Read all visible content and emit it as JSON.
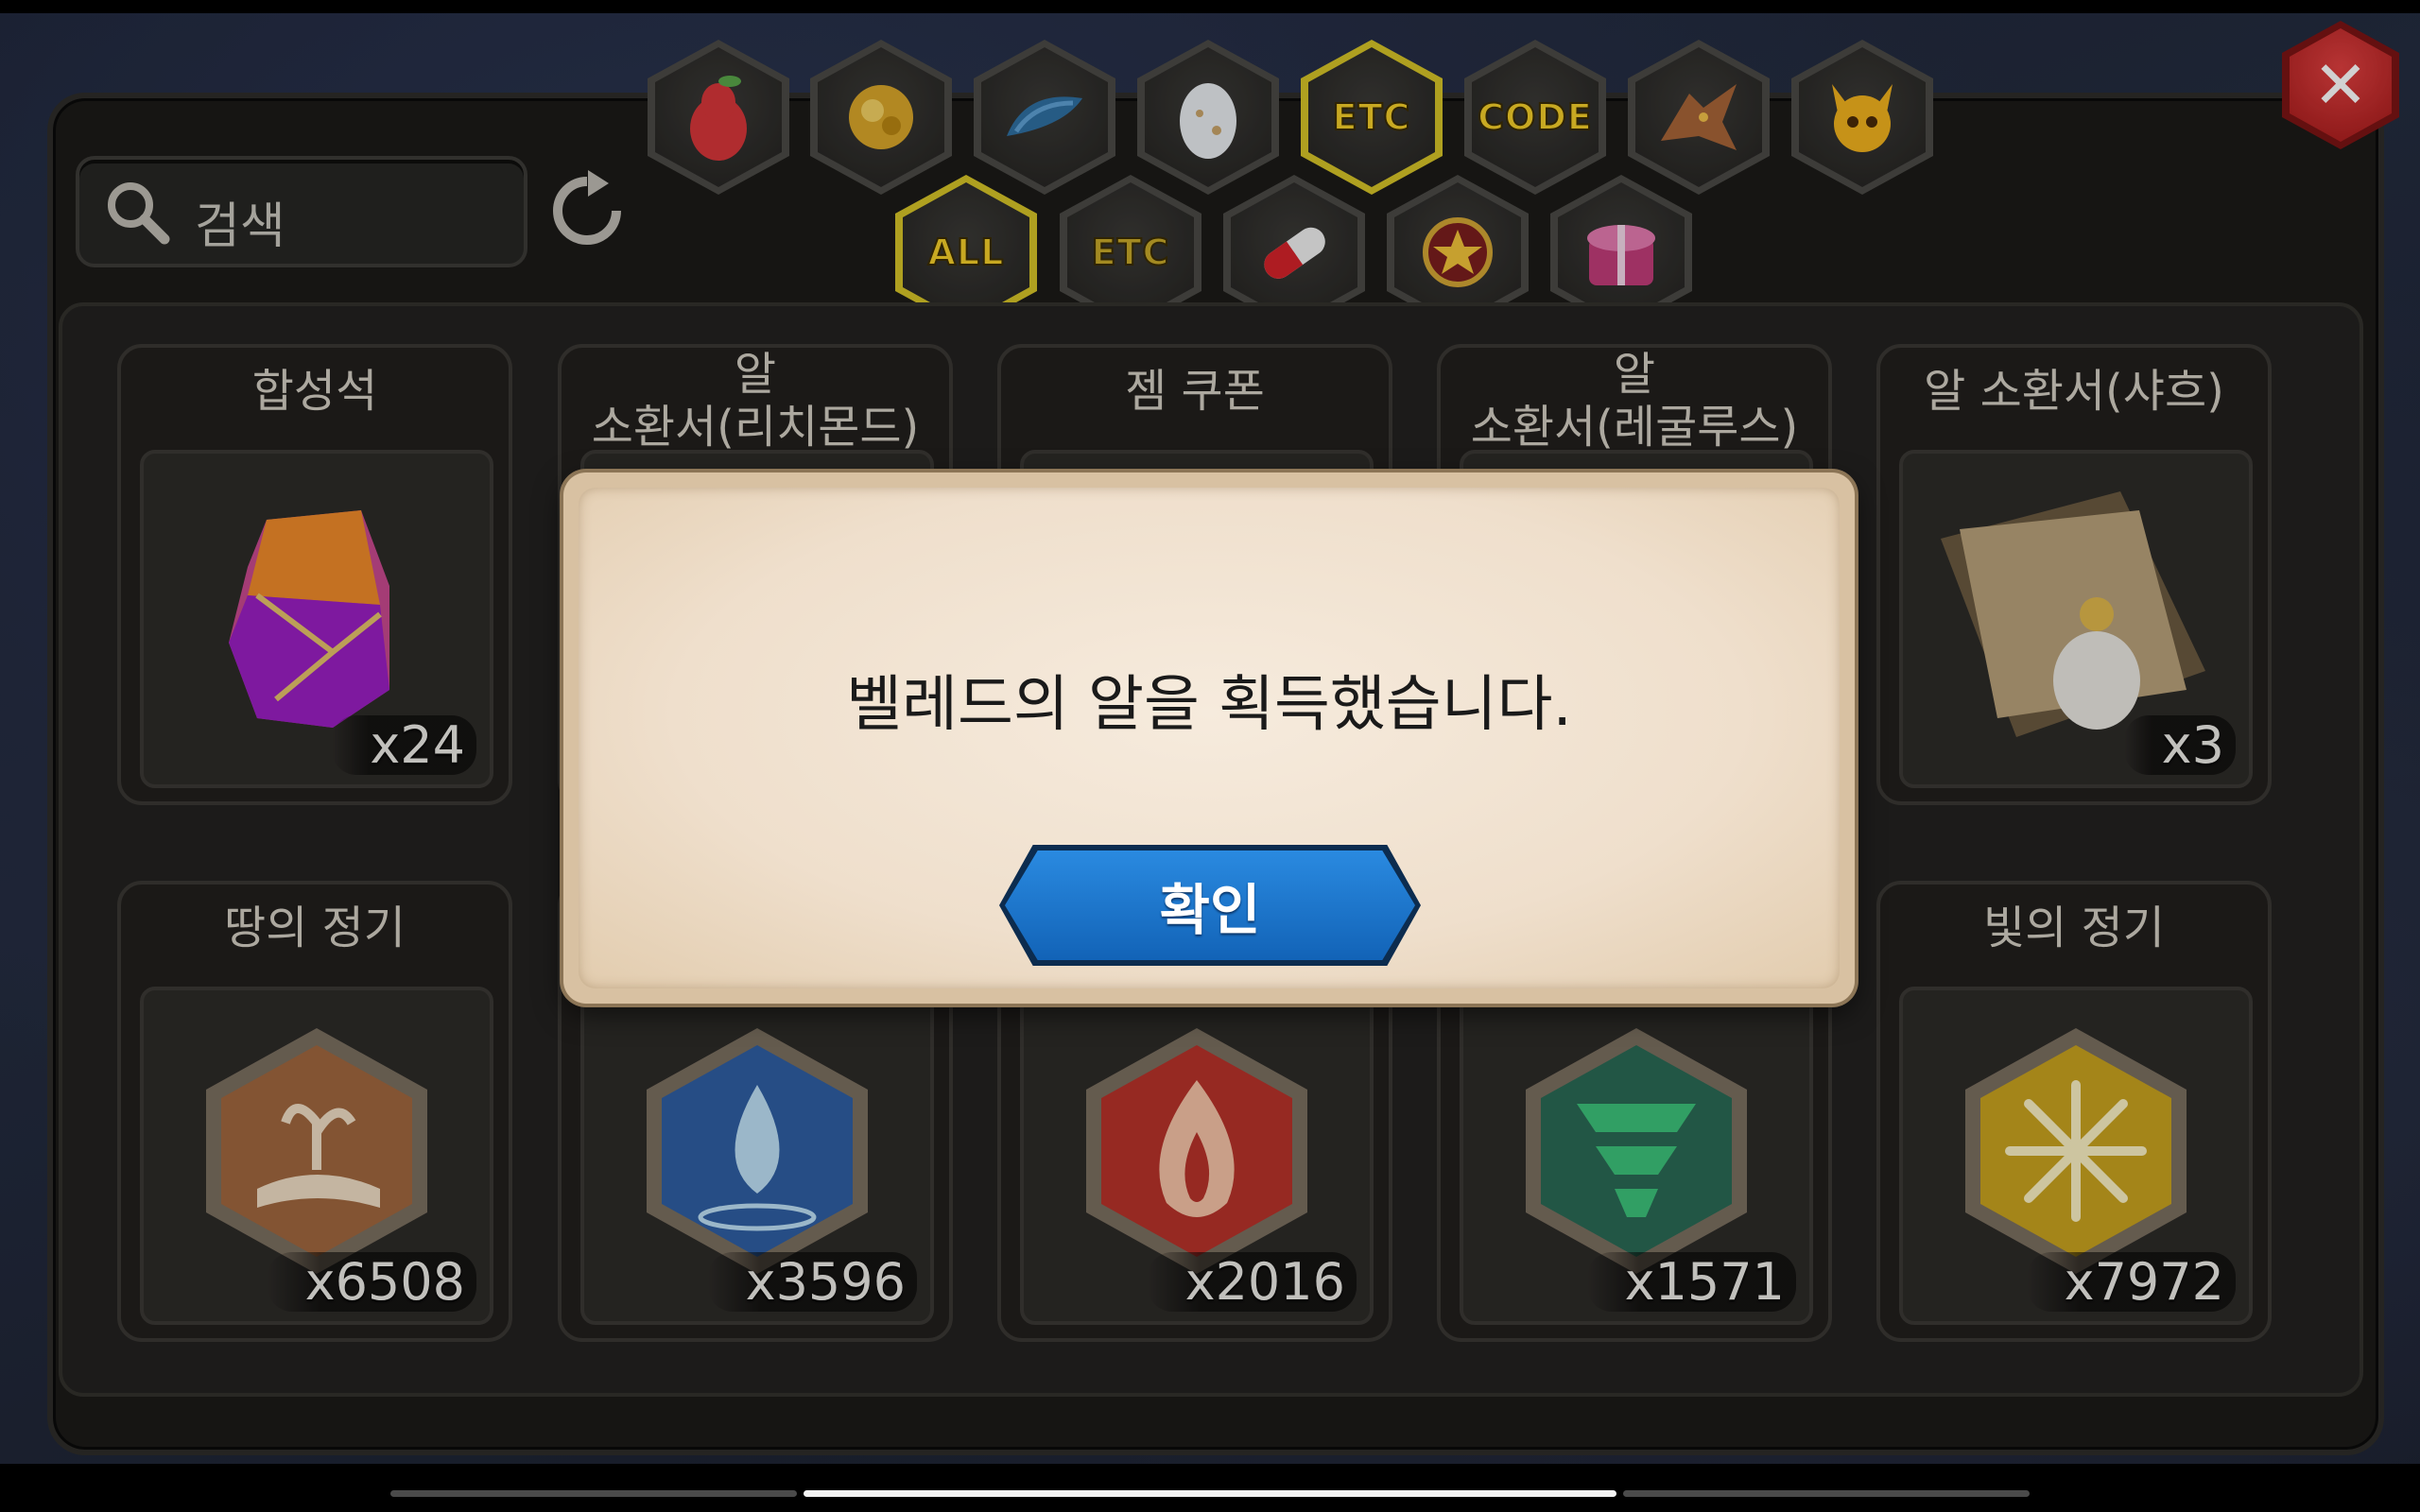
{
  "search": {
    "placeholder": "검색"
  },
  "category_tabs_row1": [
    {
      "id": "fruit",
      "icon": "pear-icon"
    },
    {
      "id": "gold",
      "icon": "gold-ore-icon"
    },
    {
      "id": "scale",
      "icon": "dragon-scale-icon"
    },
    {
      "id": "egg",
      "icon": "egg-icon"
    },
    {
      "id": "etc",
      "label": "ETC",
      "selected": true
    },
    {
      "id": "code",
      "label": "CODE"
    },
    {
      "id": "dragon",
      "icon": "dragon-head-icon"
    },
    {
      "id": "monster",
      "icon": "horned-monster-icon"
    }
  ],
  "category_tabs_row2": [
    {
      "id": "all",
      "label": "ALL",
      "selected": true
    },
    {
      "id": "etc2",
      "label": "ETC"
    },
    {
      "id": "capsule",
      "icon": "capsule-icon"
    },
    {
      "id": "medal",
      "icon": "star-medal-icon"
    },
    {
      "id": "giftbox",
      "icon": "gift-box-icon"
    }
  ],
  "items": [
    {
      "title": "합성석",
      "count": "x24",
      "icon": "synthesis-stone-icon"
    },
    {
      "title": "알\n소환서(리치몬드)",
      "count": "",
      "icon": "summon-scroll-icon"
    },
    {
      "title": "젬 쿠폰",
      "count": "",
      "icon": "gem-coupon-icon"
    },
    {
      "title": "알\n소환서(레굴루스)",
      "count": "",
      "icon": "summon-scroll-icon"
    },
    {
      "title": "알 소환서(샤흐)",
      "count": "x3",
      "icon": "summon-scroll-icon"
    },
    {
      "title": "땅의 정기",
      "count": "x6508",
      "icon": "earth-essence-icon"
    },
    {
      "title": "",
      "count": "x3596",
      "icon": "water-essence-icon"
    },
    {
      "title": "",
      "count": "x2016",
      "icon": "fire-essence-icon"
    },
    {
      "title": "",
      "count": "x1571",
      "icon": "wind-essence-icon"
    },
    {
      "title": "빛의 정기",
      "count": "x7972",
      "icon": "light-essence-icon"
    }
  ],
  "dialog": {
    "message": "벨레드의 알을 획득했습니다.",
    "confirm_label": "확인"
  },
  "colors": {
    "accent_yellow": "#f5cf2a",
    "confirm_blue": "#1a72c9",
    "close_red": "#c62828",
    "dialog_bg": "#f1e3d0"
  }
}
